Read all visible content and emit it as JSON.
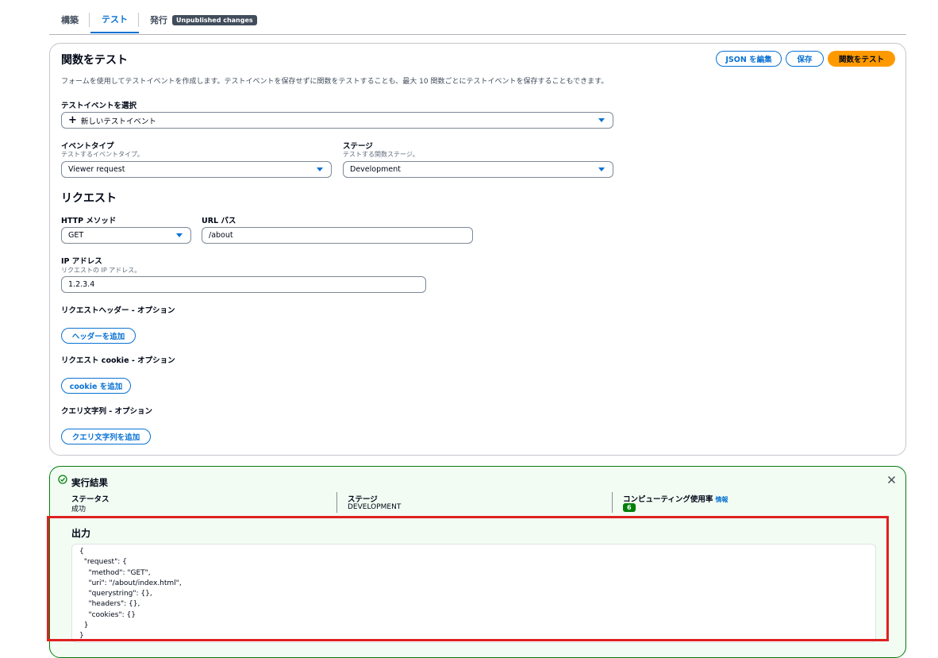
{
  "tabs": [
    {
      "label": "構築"
    },
    {
      "label": "テスト"
    },
    {
      "label": "発行",
      "badge": "Unpublished changes"
    }
  ],
  "test_panel": {
    "title": "関数をテスト",
    "description": "フォームを使用してテストイベントを作成します。テストイベントを保存せずに関数をテストすることも、最大 10 関数ごとにテストイベントを保存することもできます。",
    "buttons": {
      "edit_json": "JSON を編集",
      "save": "保存",
      "test": "関数をテスト"
    },
    "select_event": {
      "label": "テストイベントを選択",
      "value": "新しいテストイベント"
    },
    "event_type": {
      "label": "イベントタイプ",
      "sublabel": "テストするイベントタイプ。",
      "value": "Viewer request"
    },
    "stage": {
      "label": "ステージ",
      "sublabel": "テストする関数ステージ。",
      "value": "Development"
    },
    "request": {
      "title": "リクエスト",
      "http_method": {
        "label": "HTTP メソッド",
        "value": "GET"
      },
      "url_path": {
        "label": "URL パス",
        "value": "/about"
      },
      "ip": {
        "label": "IP アドレス",
        "sublabel": "リクエストの IP アドレス。",
        "value": "1.2.3.4"
      },
      "headers": {
        "label": "リクエストヘッダー - オプション",
        "button": "ヘッダーを追加"
      },
      "cookies": {
        "label": "リクエスト cookie - オプション",
        "button": "cookie を追加"
      },
      "query": {
        "label": "クエリ文字列 - オプション",
        "button": "クエリ文字列を追加"
      }
    }
  },
  "result": {
    "title": "実行結果",
    "status": {
      "label": "ステータス",
      "value": "成功"
    },
    "stage": {
      "label": "ステージ",
      "value": "DEVELOPMENT"
    },
    "compute": {
      "label": "コンピューティング使用率",
      "info": "情報",
      "value": "6"
    },
    "output": {
      "title": "出力",
      "code": "{\n  \"request\": {\n    \"method\": \"GET\",\n    \"uri\": \"/about/index.html\",\n    \"querystring\": {},\n    \"headers\": {},\n    \"cookies\": {}\n  }\n}"
    }
  },
  "colors": {
    "accent": "#0972d3",
    "primary": "#ff9900",
    "success": "#037f0c",
    "highlight": "#e02020"
  }
}
